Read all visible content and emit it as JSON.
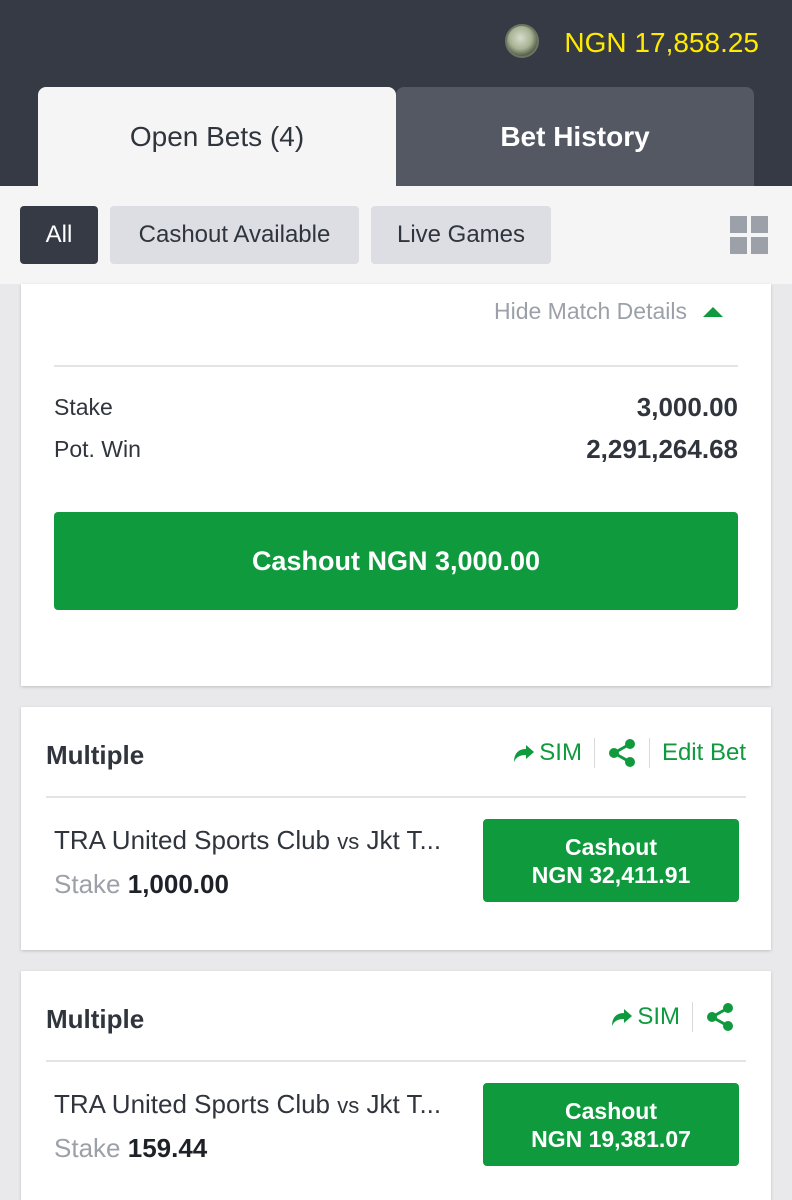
{
  "header": {
    "balance": "NGN 17,858.25",
    "avatar_icon": "user-avatar"
  },
  "tabs": [
    {
      "label": "Open Bets (4)",
      "active": true
    },
    {
      "label": "Bet History",
      "active": false
    }
  ],
  "filters": [
    {
      "label": "All",
      "active": true
    },
    {
      "label": "Cashout Available",
      "active": false
    },
    {
      "label": "Live Games",
      "active": false
    }
  ],
  "view_toggle_icon": "grid-view-icon",
  "expanded_bet": {
    "hide_details_label": "Hide Match Details",
    "stake_label": "Stake",
    "stake_value": "3,000.00",
    "pot_win_label": "Pot. Win",
    "pot_win_value": "2,291,264.68",
    "cashout_label": "Cashout NGN 3,000.00"
  },
  "bets": [
    {
      "title": "Multiple",
      "sim_label": "SIM",
      "edit_label": "Edit Bet",
      "match_home": "TRA United Sports Club",
      "match_vs": "vs",
      "match_away": "Jkt T...",
      "stake_label": "Stake",
      "stake_amount": "1,000.00",
      "cashout_line1": "Cashout",
      "cashout_line2": "NGN 32,411.91"
    },
    {
      "title": "Multiple",
      "sim_label": "SIM",
      "match_home": "TRA United Sports Club",
      "match_vs": "vs",
      "match_away": "Jkt T...",
      "stake_label": "Stake",
      "stake_amount": "159.44",
      "cashout_line1": "Cashout",
      "cashout_line2": "NGN 19,381.07"
    }
  ],
  "colors": {
    "header_bg": "#353a45",
    "balance": "#ffea00",
    "accent_green": "#0f9a3e",
    "muted_text": "#9ca0a8"
  }
}
